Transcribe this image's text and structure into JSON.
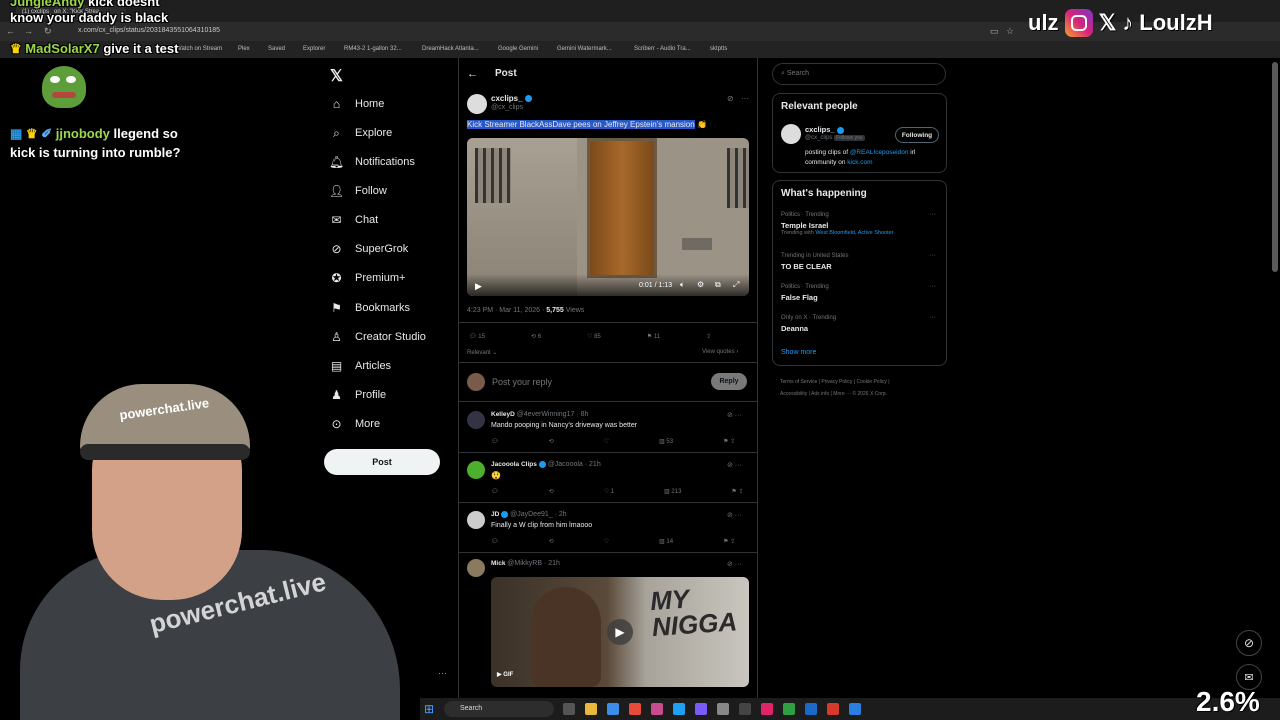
{
  "browser": {
    "tab_title": "(1) cxclips_ on X: \"Kick Strea",
    "url": "x.com/cx_clips/status/2031843551064310185",
    "bookmarks": [
      "Watch on Stream",
      "Plex",
      "Saved",
      "Explorer",
      "RM43-2 1-gallon 32...",
      "DreamHack Atlanta...",
      "Google Gemini",
      "Gemini Watermark...",
      "Scriberr - Audio Tra...",
      "sktptts"
    ]
  },
  "chat": [
    {
      "user": "JungleAndy",
      "text": "kick doesnt know your daddy is black"
    },
    {
      "user": "MadSolarX7",
      "text": "give it a test"
    },
    {
      "user": "jjnobody",
      "text": "llegend so kick is turning into rumble?"
    }
  ],
  "social": {
    "handle": "LoulzH",
    "prefix": "ulz"
  },
  "nav": {
    "items": [
      "Home",
      "Explore",
      "Notifications",
      "Follow",
      "Chat",
      "SuperGrok",
      "Premium+",
      "Bookmarks",
      "Creator Studio",
      "Articles",
      "Profile",
      "More"
    ],
    "post_button": "Post"
  },
  "header": {
    "title": "Post"
  },
  "tweet": {
    "name": "cxclips_",
    "handle": "@cx_clips",
    "text": "Kick Streamer BlackAssDave pees on Jeffrey Epstein's mansion",
    "emoji": "👏",
    "video_time": "0:01 / 1:13",
    "meta_time": "4:23 PM · Mar 11, 2026 · ",
    "views": "5,755",
    "views_label": " Views",
    "counts": {
      "replies": "15",
      "reposts": "6",
      "likes": "85",
      "bookmarks": "11"
    },
    "sort": "Relevant",
    "view_quotes": "View quotes"
  },
  "compose": {
    "placeholder": "Post your reply",
    "button": "Reply"
  },
  "replies": [
    {
      "name": "KelleyD",
      "handle": "@4everWinning17 · 8h",
      "text": "Mando pooping in Nancy's driveway was better",
      "likes": "",
      "views": "53"
    },
    {
      "name": "Jacooola Clips",
      "handle": "@Jacooola · 21h",
      "text": "😲",
      "likes": "1",
      "views": "213"
    },
    {
      "name": "JD",
      "handle": "@JayDee91_ · 2h",
      "text": "Finally a W clip from him lmaooo",
      "likes": "",
      "views": "14"
    },
    {
      "name": "Mick",
      "handle": "@MikkyRB · 21h",
      "text": "",
      "gif_label": "GIF",
      "gif_caption": "MY NIGGA"
    }
  ],
  "search": {
    "placeholder": "Search"
  },
  "relevant": {
    "title": "Relevant people",
    "name": "cxclips_",
    "handle": "@cx_clips",
    "follows_you": "Follows you",
    "button": "Following",
    "bio_pre": "posting clips of ",
    "bio_link": "@REALIceposeidon",
    "bio_mid": " irl community on ",
    "bio_link2": "kick.com"
  },
  "happening": {
    "title": "What's happening",
    "trends": [
      {
        "context": "Politics · Trending",
        "name": "Temple Israel",
        "sub_pre": "Trending with ",
        "sub": "West Bloomfield, Active Shooter"
      },
      {
        "context": "Trending in United States",
        "name": "TO BE CLEAR",
        "sub_pre": "",
        "sub": ""
      },
      {
        "context": "Politics · Trending",
        "name": "False Flag",
        "sub_pre": "",
        "sub": ""
      },
      {
        "context": "Only on X · Trending",
        "name": "Deanna",
        "sub_pre": "",
        "sub": ""
      }
    ],
    "show_more": "Show more"
  },
  "footer": [
    "Terms of Service",
    "Privacy Policy",
    "Cookie Policy",
    "Accessibility",
    "Ads info",
    "More ···",
    "© 2026 X Corp."
  ],
  "taskbar": {
    "search": "Search"
  },
  "overlay": {
    "percent": "2.6%"
  },
  "colors": {
    "accent": "#1d9bf0",
    "bg": "#000000",
    "border": "#2f3336"
  }
}
